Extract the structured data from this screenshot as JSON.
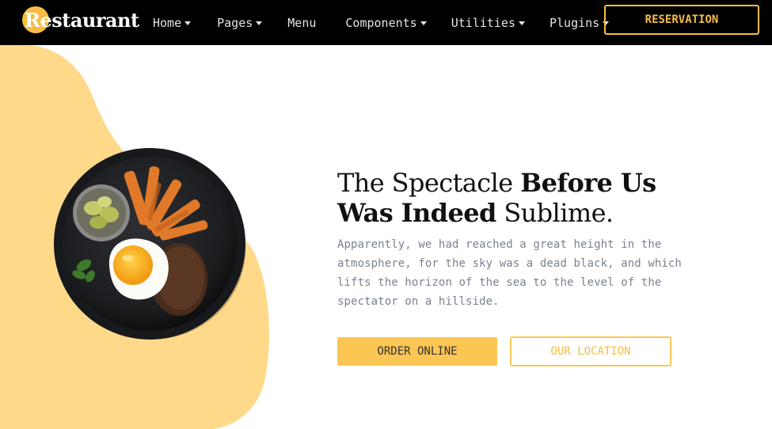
{
  "brand": {
    "name": "Restaurant",
    "accent_color": "#f6bc45",
    "blob_color": "#ffd98a"
  },
  "nav": {
    "items": [
      {
        "label": "Home",
        "has_dropdown": true
      },
      {
        "label": "Pages",
        "has_dropdown": true
      },
      {
        "label": "Menu",
        "has_dropdown": false
      },
      {
        "label": "Components",
        "has_dropdown": true
      },
      {
        "label": "Utilities",
        "has_dropdown": true
      },
      {
        "label": "Plugins",
        "has_dropdown": true
      }
    ],
    "reservation_label": "RESERVATION"
  },
  "hero": {
    "headline_part1": "The Spectacle ",
    "headline_bold1": "Before Us",
    "headline_bold2": "Was Indeed",
    "headline_part2": " Sublime.",
    "description": "Apparently, we had reached a great height in the atmosphere, for the sky was a dead black, and which lifts the horizon of the sea to the level of the spectator on a hillside.",
    "order_label": "ORDER ONLINE",
    "location_label": "OUR LOCATION",
    "image_icon": "food-plate-image"
  }
}
